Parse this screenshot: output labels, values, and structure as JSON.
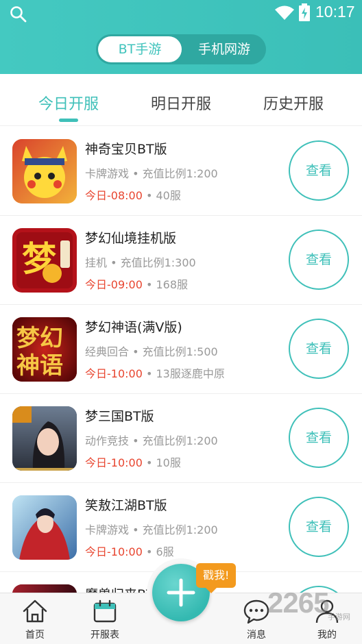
{
  "status": {
    "time": "10:17"
  },
  "segment": {
    "active": "BT手游",
    "other": "手机网游"
  },
  "tabs": [
    "今日开服",
    "明日开服",
    "历史开服"
  ],
  "games": [
    {
      "name": "神奇宝贝BT版",
      "meta": "卡牌游戏 • 充值比例1:200",
      "time": "今日-08:00",
      "server": " • 40服",
      "button": "查看"
    },
    {
      "name": "梦幻仙境挂机版",
      "meta": "挂机 • 充值比例1:300",
      "time": "今日-09:00",
      "server": " • 168服",
      "button": "查看"
    },
    {
      "name": "梦幻神语(满V版)",
      "meta": "经典回合 • 充值比例1:500",
      "time": "今日-10:00",
      "server": " • 13服逐鹿中原",
      "button": "查看"
    },
    {
      "name": "梦三国BT版",
      "meta": "动作竞技 • 充值比例1:200",
      "time": "今日-10:00",
      "server": " • 10服",
      "button": "查看"
    },
    {
      "name": "笑敖江湖BT版",
      "meta": "卡牌游戏 • 充值比例1:200",
      "time": "今日-10:00",
      "server": " • 6服",
      "button": "查看"
    },
    {
      "name": "魔兽归来BT",
      "meta": "",
      "time": "",
      "server": "",
      "button": ""
    }
  ],
  "nav": {
    "home": "首页",
    "schedule": "开服表",
    "messages": "消息",
    "mine": "我的"
  },
  "promo": "戳我!",
  "watermark": {
    "number": "2265",
    "suffix": "手游网"
  },
  "colors": {
    "accent": "#3fc0b9",
    "time_red": "#e8452f",
    "promo": "#f39a1e"
  }
}
